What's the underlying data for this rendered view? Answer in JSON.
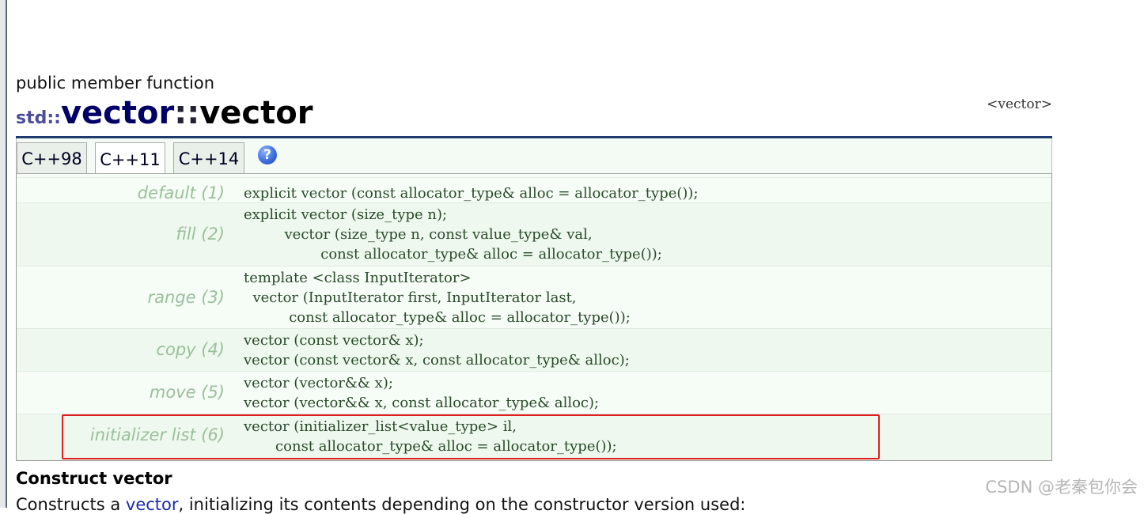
{
  "header": {
    "kind": "public member function",
    "namespace": "std::",
    "class_name": "vector",
    "separator": "::",
    "member_name": "vector",
    "header_link": "<vector>"
  },
  "tabs": [
    {
      "label": "C++98",
      "active": false
    },
    {
      "label": "C++11",
      "active": true
    },
    {
      "label": "C++14",
      "active": false
    }
  ],
  "help_icon": {
    "icon": "question-mark-icon",
    "glyph": "?"
  },
  "signatures": [
    {
      "label": "default (1)",
      "code": "explicit vector (const allocator_type& alloc = allocator_type());"
    },
    {
      "label": "fill (2)",
      "code": "explicit vector (size_type n);\n         vector (size_type n, const value_type& val,\n                 const allocator_type& alloc = allocator_type());"
    },
    {
      "label": "range (3)",
      "code": "template <class InputIterator>\n  vector (InputIterator first, InputIterator last,\n          const allocator_type& alloc = allocator_type());"
    },
    {
      "label": "copy (4)",
      "code": "vector (const vector& x);\nvector (const vector& x, const allocator_type& alloc);"
    },
    {
      "label": "move (5)",
      "code": "vector (vector&& x);\nvector (vector&& x, const allocator_type& alloc);"
    },
    {
      "label": "initializer list (6)",
      "code": "vector (initializer_list<value_type> il,\n       const allocator_type& alloc = allocator_type());"
    }
  ],
  "section": {
    "heading": "Construct vector",
    "desc_before": "Constructs a ",
    "desc_link": "vector",
    "desc_after": ", initializing its contents depending on the constructor version used:"
  },
  "watermark": "CSDN @老秦包你会",
  "colors": {
    "title_rule": "#1e3a6e",
    "highlight_border": "#e02020",
    "label_green": "#9bbf9b",
    "table_bg": "#f6fcf6"
  }
}
